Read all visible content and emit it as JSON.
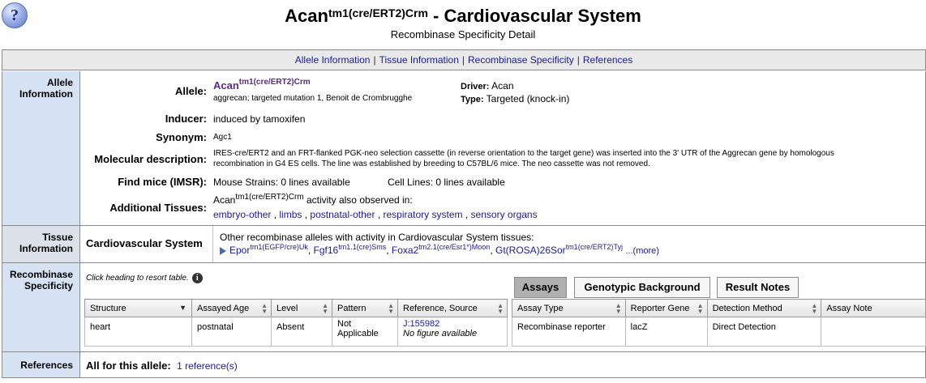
{
  "header": {
    "help_icon": "?",
    "title_main": "Acan",
    "title_sup": "tm1(cre/ERT2)Crm",
    "title_rest": " - Cardiovascular System",
    "subtitle": "Recombinase Specificity Detail"
  },
  "nav": {
    "items": [
      "Allele Information",
      "Tissue Information",
      "Recombinase Specificity",
      "References"
    ],
    "separator": "|"
  },
  "allele_section": {
    "label": "Allele Information",
    "allele_label": "Allele:",
    "allele_symbol": "Acan",
    "allele_sup": "tm1(cre/ERT2)Crm",
    "allele_name": "aggrecan; targeted mutation 1, Benoit de Crombrugghe",
    "driver_label": "Driver:",
    "driver_value": "Acan",
    "type_label": "Type:",
    "type_value": "Targeted (knock-in)",
    "inducer_label": "Inducer:",
    "inducer_value": "induced by tamoxifen",
    "synonym_label": "Synonym:",
    "synonym_value": "Agc1",
    "moldesc_label": "Molecular description:",
    "moldesc_line1": "IRES-cre/ERT2 and an FRT-flanked PGK-neo selection cassette (in reverse orientation to the target gene) was inserted into the 3' UTR of the Aggrecan gene by homologous",
    "moldesc_line2": "recombination in G4 ES cells. The line was established by breeding to C57BL/6 mice. The neo cassette was not removed.",
    "findmice_label": "Find mice (IMSR):",
    "mouse_strains": "Mouse Strains: 0 lines available",
    "cell_lines": "Cell Lines: 0 lines available",
    "addtissue_label": "Additional Tissues:",
    "addtissue_sym": "Acan",
    "addtissue_sup": "tm1(cre/ERT2)Crm",
    "addtissue_text": " activity also observed in:",
    "tissues": [
      "embryo-other",
      "limbs",
      "postnatal-other",
      "respiratory system",
      "sensory organs"
    ]
  },
  "tissue_section": {
    "label": "Tissue Information",
    "system": "Cardiovascular System",
    "other_text": "Other recombinase alleles with activity in Cardiovascular System tissues:",
    "alleles": [
      {
        "sym": "Epor",
        "sup": "tm1(EGFP/cre)Uk"
      },
      {
        "sym": "Fgf16",
        "sup": "tm1.1(cre)Sms"
      },
      {
        "sym": "Foxa2",
        "sup": "tm2.1(cre/Esr1*)Moon"
      },
      {
        "sym": "Gt(ROSA)26Sor",
        "sup": "tm1(cre/ERT2)Tyj"
      }
    ],
    "more": "...(more)"
  },
  "recombinase_section": {
    "label": "Recombinase Specificity",
    "hint": "Click heading to resort table.",
    "info_icon": "i",
    "tabs": [
      "Assays",
      "Genotypic Background",
      "Result Notes"
    ],
    "left_columns": [
      "Structure",
      "Assayed Age",
      "Level",
      "Pattern",
      "Reference, Source"
    ],
    "right_columns": [
      "Assay Type",
      "Reporter Gene",
      "Detection Method",
      "Assay Note"
    ],
    "row": {
      "structure": "heart",
      "age": "postnatal",
      "level": "Absent",
      "pattern": "Not Applicable",
      "reference": "J:155982",
      "figure": "No figure available",
      "assay_type": "Recombinase reporter",
      "reporter_gene": "lacZ",
      "detection": "Direct Detection",
      "note": ""
    }
  },
  "references_section": {
    "label": "References",
    "all_label": "All for this allele:",
    "link": "1 reference(s)"
  }
}
